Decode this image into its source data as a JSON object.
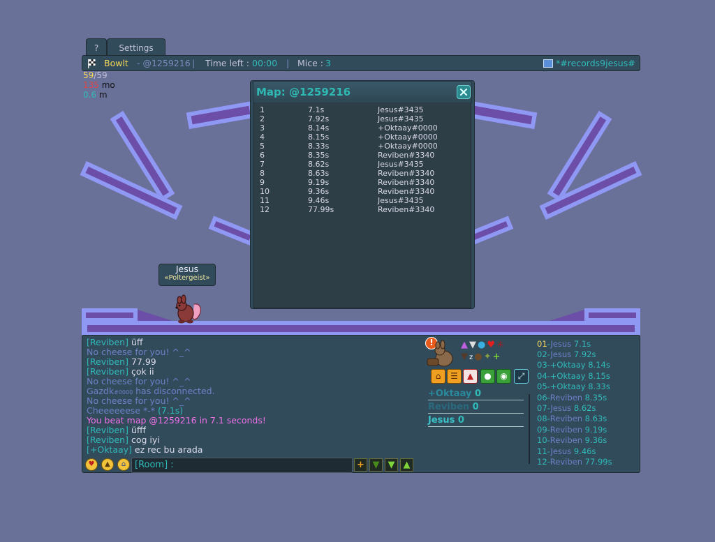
{
  "tabs": {
    "help": "?",
    "settings": "Settings"
  },
  "topbar": {
    "map_author": "Bowlt",
    "map_code": "- @1259216",
    "time_label": "Time left :",
    "time_value": "00:00",
    "mice_label": "Mice :",
    "mice_value": "3",
    "room_name": "*#records9jesus#"
  },
  "stats": {
    "fps_current": "59",
    "fps_max": "/59",
    "ping": "135",
    "ping_unit": " mo",
    "distance": "0.6",
    "distance_unit": " m"
  },
  "player": {
    "name": "Jesus",
    "title": "«Poltergeist»"
  },
  "popup": {
    "title": "Map: @1259216",
    "records": [
      {
        "rank": "1",
        "time": "7.1s",
        "name": "Jesus#3435"
      },
      {
        "rank": "2",
        "time": "7.92s",
        "name": "Jesus#3435"
      },
      {
        "rank": "3",
        "time": "8.14s",
        "name": "+Oktaay#0000"
      },
      {
        "rank": "4",
        "time": "8.15s",
        "name": "+Oktaay#0000"
      },
      {
        "rank": "5",
        "time": "8.33s",
        "name": "+Oktaay#0000"
      },
      {
        "rank": "6",
        "time": "8.35s",
        "name": "Reviben#3340"
      },
      {
        "rank": "7",
        "time": "8.62s",
        "name": "Jesus#3435"
      },
      {
        "rank": "8",
        "time": "8.63s",
        "name": "Reviben#3340"
      },
      {
        "rank": "9",
        "time": "9.19s",
        "name": "Reviben#3340"
      },
      {
        "rank": "10",
        "time": "9.36s",
        "name": "Reviben#3340"
      },
      {
        "rank": "11",
        "time": "9.46s",
        "name": "Jesus#3435"
      },
      {
        "rank": "12",
        "time": "77.99s",
        "name": "Reviben#3340"
      }
    ]
  },
  "chat": {
    "lines": [
      {
        "name": "[Reviben]",
        "text": " üff"
      },
      {
        "sys": "No cheese for you! ^_^"
      },
      {
        "name": "[Reviben]",
        "text": " 77.99"
      },
      {
        "name": "[Reviben]",
        "text": " çok ii"
      },
      {
        "sys": "No cheese for you! ^_^"
      },
      {
        "sys": "Gazdk",
        "small": "#0000",
        "sys2": " has disconnected."
      },
      {
        "sys": "No cheese for you! ^_^"
      },
      {
        "sys": "Cheeeeeese *-* ",
        "time": "(7.1s)"
      },
      {
        "win": "You beat map @1259216 in 7.1 seconds!"
      },
      {
        "name": "[Reviben]",
        "text": " üfff"
      },
      {
        "name": "[Reviben]",
        "text": " cog iyi"
      },
      {
        "name": "[+Oktaay]",
        "text": " ez rec bu arada"
      }
    ],
    "input_prefix": "[Room] :"
  },
  "scores": [
    {
      "name": "+Oktaay",
      "score": "0"
    },
    {
      "name": "Reviben",
      "score": "0"
    },
    {
      "name": "Jesus",
      "score": "0"
    }
  ],
  "leaderboard": [
    {
      "rank": "01",
      "sep": "-",
      "name": "Jesus",
      "time": "7.1s"
    },
    {
      "rank": "02",
      "sep": "-",
      "name": "Jesus",
      "time": "7.92s"
    },
    {
      "rank": "03",
      "sep": "-",
      "name": "+Oktaay",
      "time": "8.14s"
    },
    {
      "rank": "04",
      "sep": "-",
      "name": "+Oktaay",
      "time": "8.15s"
    },
    {
      "rank": "05",
      "sep": "-",
      "name": "+Oktaay",
      "time": "8.33s"
    },
    {
      "rank": "06",
      "sep": "-",
      "name": "Reviben",
      "time": "8.35s"
    },
    {
      "rank": "07",
      "sep": "-",
      "name": "Jesus",
      "time": "8.62s"
    },
    {
      "rank": "08",
      "sep": "-",
      "name": "Reviben",
      "time": "8.63s"
    },
    {
      "rank": "09",
      "sep": "-",
      "name": "Reviben",
      "time": "9.19s"
    },
    {
      "rank": "10",
      "sep": "-",
      "name": "Reviben",
      "time": "9.36s"
    },
    {
      "rank": "11",
      "sep": "-",
      "name": "Jesus",
      "time": "9.46s"
    },
    {
      "rank": "12",
      "sep": "-",
      "name": "Reviben",
      "time": "77.99s"
    }
  ],
  "colors": {
    "background": "#6a7198",
    "panel": "#324b5a",
    "accent_teal": "#30baba",
    "beam_fill": "#6c4ea8",
    "beam_border": "#8f99f3",
    "win_text": "#ef70e9",
    "leader_gold": "#f5d85a"
  },
  "icons": {
    "flag": "checkered-flag-icon",
    "room": "room-icon",
    "close": "close-icon",
    "alert": "exclamation-icon"
  }
}
